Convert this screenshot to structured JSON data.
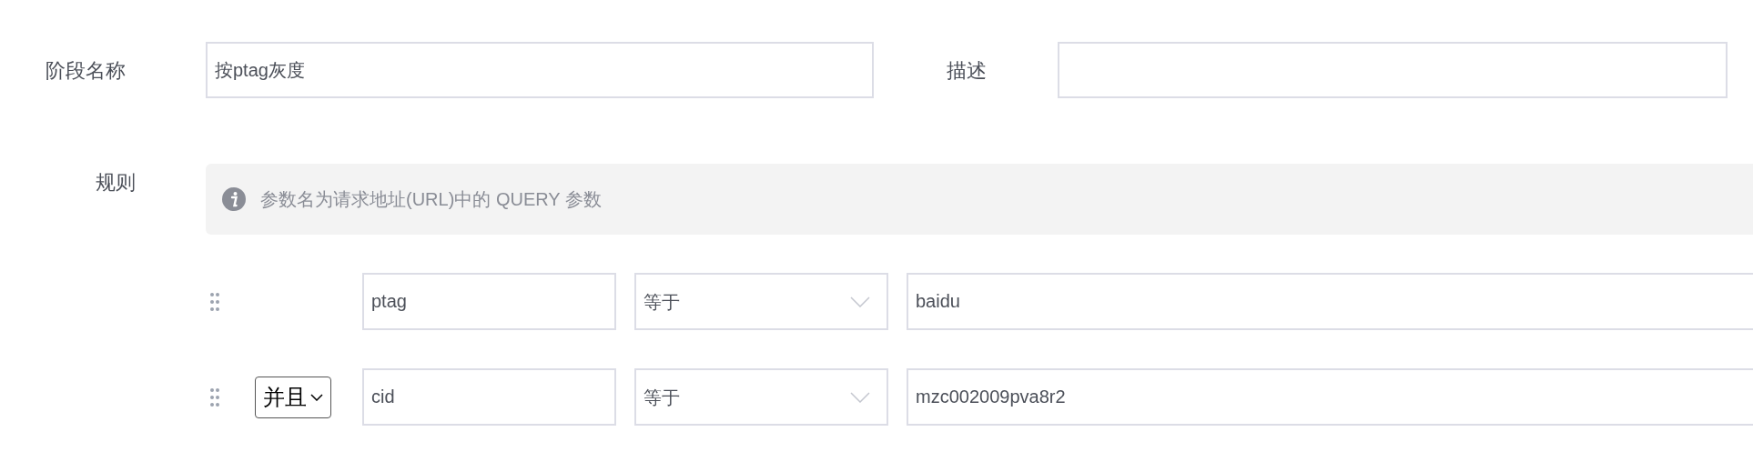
{
  "stage_name": {
    "label": "阶段名称",
    "value": "按ptag灰度"
  },
  "description": {
    "label": "描述"
  },
  "rules": {
    "label": "规则",
    "notice": "参数名为请求地址(URL)中的 QUERY 参数",
    "conditions": [
      {
        "param": "ptag",
        "operator": "等于",
        "value": "baidu"
      },
      {
        "logic": "并且",
        "param": "cid",
        "operator": "等于",
        "value": "mzc002009pva8r2"
      }
    ]
  }
}
